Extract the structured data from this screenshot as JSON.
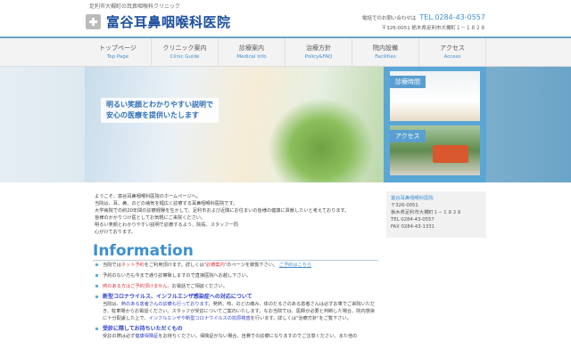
{
  "header": {
    "tagline": "足利市大槻町の耳鼻咽喉科クリニック",
    "clinic_name": "富谷耳鼻咽喉科医院",
    "contact_label": "電話でのお問い合わせは",
    "tel": "TEL.0284-43-0557",
    "address": "〒326-0051 栃木県足利市大槻町１－１８２８"
  },
  "nav": [
    {
      "jp": "トップページ",
      "en": "Top Page"
    },
    {
      "jp": "クリニック案内",
      "en": "Clinic Guide"
    },
    {
      "jp": "診療案内",
      "en": "Medical Info"
    },
    {
      "jp": "治療方針",
      "en": "Policy&FAQ"
    },
    {
      "jp": "院内設備",
      "en": "Facilities"
    },
    {
      "jp": "アクセス",
      "en": "Access"
    }
  ],
  "hero": {
    "catch1": "明るい笑顔とわかりやすい説明で",
    "catch2": "安心の医療を提供いたします",
    "card1": "診療時間",
    "card2": "アクセス"
  },
  "intro": [
    "ようこそ、富谷耳鼻咽喉科医院のホームページへ。",
    "当院は、耳、鼻、のどの病気を幅広く診療する耳鼻咽喉科医院です。",
    "大学病院での約20年間の診療経験を生かして、足利市および近隣にお住まいの皆様の健康に貢献したいと考えております。",
    "皆様のかかりつけ医としてお気軽にご来院ください。",
    "明るい笑顔とわかりやすい説明で診療するよう、院長、スタッフ一同",
    "心がけております。"
  ],
  "info": {
    "title": "Information",
    "i1": {
      "a": "当院では",
      "b": "ネット予約",
      "c": "をご利用頂けます。詳しくは",
      "d": "\"診療案内\"",
      "e": "のページを御覧下さい。",
      "link": "ご予約はこちら"
    },
    "i2": "予約のない方も今まで通り診察致しますので直接医院へお越し下さい。",
    "i3": {
      "a": "熱のある方はご予約頂けません。",
      "b": "お電話でご相談ください。"
    },
    "i4": {
      "title": "新型コロナウイルス、インフルエンザ感染症への対応について",
      "a": "当院は、",
      "b": "熱のある患者さんの診療も行っております。",
      "c": "発熱、咳、のどの痛み、体のだるさのある患者さんは必ずお車でご来院いただき、駐車場からお電話ください。スタッフが受診についてご案内いたします。なお当院では、医師が必要と判断した場合、院内感染に十分配慮した上で、",
      "d": "インフルエンザや新型コロナウイルスの抗原検査",
      "e": "を行います。詳しくは\"治療方針\"をご覧下さい。"
    },
    "i5": {
      "title": "受診に際してお持ちいただくもの",
      "a": "受診の際は必ず",
      "b": "健康保険証",
      "c": "をお持ちください。保険証がない場合、自費での診療になりますのでご注意ください。また他の"
    }
  },
  "sidebar": {
    "name": "富谷耳鼻咽喉科医院",
    "zip": "〒326-0051",
    "address": "栃木県足利市大槻町１－１８２８",
    "tel": "TEL 0284-43-0557",
    "fax": "FAX 0284-43-1331"
  }
}
